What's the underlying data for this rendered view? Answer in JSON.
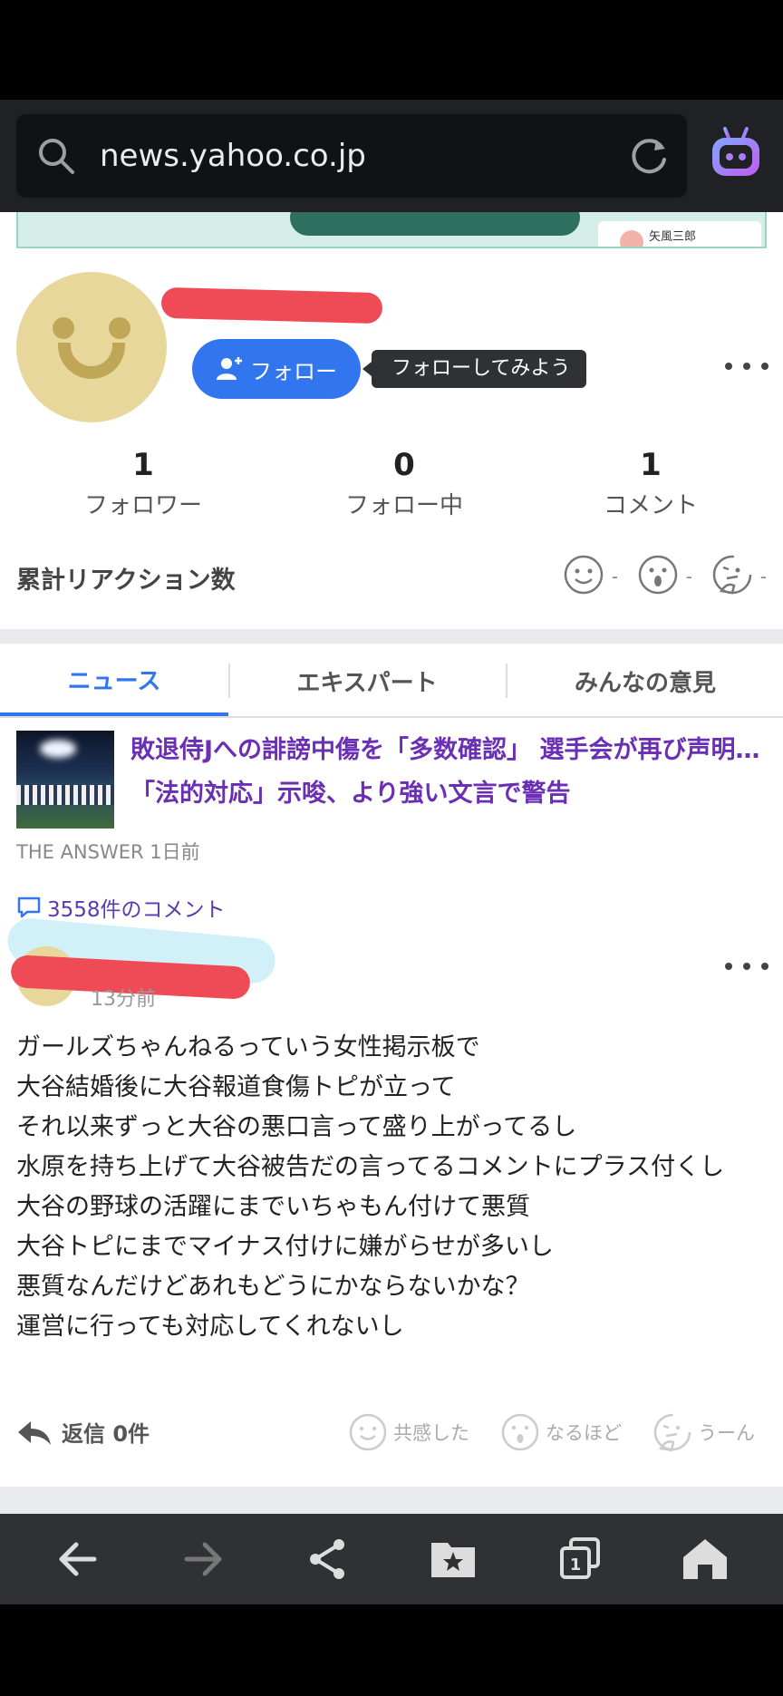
{
  "browser": {
    "url": "news.yahoo.co.jp"
  },
  "ad": {
    "name": "矢風三郎"
  },
  "profile": {
    "follow_label": "フォロー",
    "follow_tooltip": "フォローしてみよう",
    "stats": [
      {
        "value": "1",
        "label": "フォロワー"
      },
      {
        "value": "0",
        "label": "フォロー中"
      },
      {
        "value": "1",
        "label": "コメント"
      }
    ],
    "reaction_title": "累計リアクション数",
    "reaction_values": [
      "-",
      "-",
      "-"
    ]
  },
  "tabs": [
    {
      "label": "ニュース",
      "active": true
    },
    {
      "label": "エキスパート",
      "active": false
    },
    {
      "label": "みんなの意見",
      "active": false
    }
  ],
  "article": {
    "title": "敗退侍Jへの誹謗中傷を「多数確認」 選手会が再び声明…「法的対応」示唆、より強い文言で警告",
    "source": "THE ANSWER",
    "time": "1日前",
    "comment_count": "3558件のコメント"
  },
  "comment": {
    "time": "13分前",
    "lines": [
      "ガールズちゃんねるっていう女性掲示板で",
      "大谷結婚後に大谷報道食傷トピが立って",
      "それ以来ずっと大谷の悪口言って盛り上がってるし",
      "水原を持ち上げて大谷被告だの言ってるコメントにプラス付くし",
      "大谷の野球の活躍にまでいちゃもん付けて悪質",
      "大谷トピにまでマイナス付けに嫌がらせが多いし",
      "悪質なんだけどあれもどうにかならないかな？",
      "運営に行っても対応してくれないし"
    ],
    "reply_label": "返信 0件",
    "reactions": [
      "共感した",
      "なるほど",
      "うーん"
    ]
  },
  "colors": {
    "accent": "#3276ef",
    "article_title": "#6a2fb5",
    "redaction": "#ef4b57"
  }
}
